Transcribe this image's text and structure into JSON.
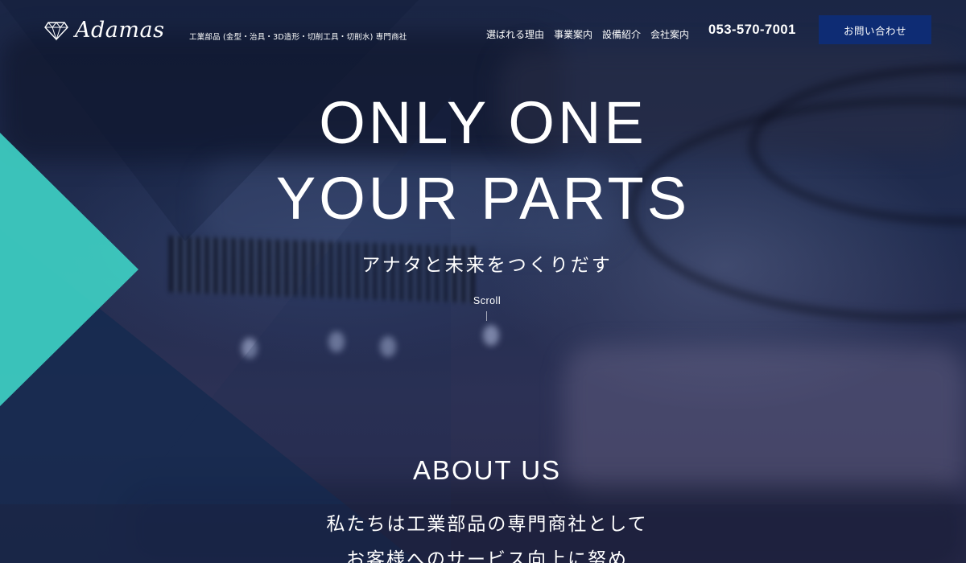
{
  "header": {
    "logo_text": "Adamas",
    "tagline": "工業部品 (金型・治具・3D造形・切削工具・切削水) 専門商社",
    "nav": [
      {
        "label": "選ばれる理由"
      },
      {
        "label": "事業案内"
      },
      {
        "label": "設備紹介"
      },
      {
        "label": "会社案内"
      }
    ],
    "phone": "053-570-7001",
    "contact_button": "お問い合わせ"
  },
  "hero": {
    "title_line1": "ONLY ONE",
    "title_line2": "YOUR PARTS",
    "subtitle": "アナタと未来をつくりだす",
    "scroll": "Scroll"
  },
  "about": {
    "title": "ABOUT US",
    "lines": [
      "私たちは工業部品の専門商社として",
      "お客様へのサービス向上に努め"
    ]
  },
  "colors": {
    "accent_teal": "#3ecfc3",
    "navy_button": "#0e2c74",
    "deep_navy": "#12294f"
  },
  "icons": {
    "logo_mark": "faceted-gem-icon"
  }
}
